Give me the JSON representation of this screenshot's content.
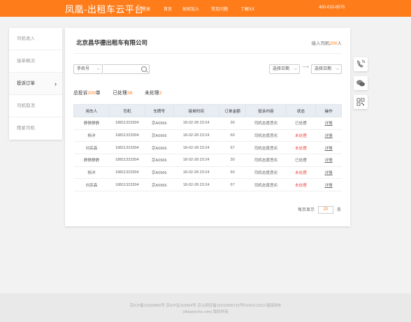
{
  "header": {
    "brand": "凤凰-出租车云平台",
    "nav": [
      "登录",
      "首页",
      "如何加入",
      "常见问题",
      "了解XX"
    ],
    "phone": "400-010-8575"
  },
  "sidebar": {
    "items": [
      {
        "label": "司机收入"
      },
      {
        "label": "接单概况"
      },
      {
        "label": "投诉订单",
        "chevron": "›"
      },
      {
        "label": "司机取消"
      },
      {
        "label": "租星司机"
      }
    ]
  },
  "panel": {
    "company": "北京昌华德出租车有限公司",
    "joined_prefix": "接入司机",
    "joined_count": "200",
    "joined_suffix": "人"
  },
  "filters": {
    "field_select": "手机号",
    "search_value": "",
    "date_start": "选择日期",
    "date_end": "选择日期",
    "range_arrow": "⟶"
  },
  "stats": {
    "total_label": "总投诉",
    "total_value": "200",
    "total_unit": "单",
    "done_label": "已处理",
    "done_value": "28",
    "pending_label": "未处理",
    "pending_value": "2"
  },
  "table": {
    "columns": [
      "用车人",
      "司机",
      "车牌号",
      "接单时间",
      "订单金额",
      "投诉内容",
      "状态",
      "操作"
    ],
    "rows": [
      {
        "rider": "静静静静",
        "driver": "18811323304",
        "plate": "京A0966",
        "time": "18-02-28  23:24",
        "amount": "30",
        "content": "司机态度恶劣",
        "status": "已处理",
        "pending": false,
        "action": "详情"
      },
      {
        "rider": "杨洋",
        "driver": "18811323304",
        "plate": "京A0966",
        "time": "18-02-28  23:24",
        "amount": "60",
        "content": "司机态度恶劣",
        "status": "未处理",
        "pending": true,
        "action": "详情"
      },
      {
        "rider": "刘亮森",
        "driver": "18811323304",
        "plate": "京A0966",
        "time": "18-02-28  23:24",
        "amount": "67",
        "content": "司机态度恶劣",
        "status": "未处理",
        "pending": true,
        "action": "详情"
      },
      {
        "rider": "静静静静",
        "driver": "18811323304",
        "plate": "京A0966",
        "time": "18-02-28  23:24",
        "amount": "30",
        "content": "司机态度恶劣",
        "status": "已处理",
        "pending": false,
        "action": "详情"
      },
      {
        "rider": "杨洋",
        "driver": "18811323304",
        "plate": "京A0966",
        "time": "18-02-28  23:24",
        "amount": "60",
        "content": "司机态度恶劣",
        "status": "未处理",
        "pending": true,
        "action": "详情"
      },
      {
        "rider": "刘亮森",
        "driver": "18811323304",
        "plate": "京A0966",
        "time": "18-02-28  23:24",
        "amount": "67",
        "content": "司机态度恶劣",
        "status": "未处理",
        "pending": true,
        "action": "详情"
      }
    ]
  },
  "pager": {
    "label": "每页显示",
    "value": "20",
    "unit": "条"
  },
  "float_tools": [
    "phone-icon",
    "chat-icon",
    "qrcode-icon"
  ],
  "footer": {
    "line1": "京ICP备10203456号 京ICP证110064号 京公网安备11010500715号©2010-2013 瑞丽网车",
    "line2": "(didapinche.com) 版权所有"
  },
  "colors": {
    "accent": "#ff7c1a",
    "danger": "#f04848",
    "header_row": "#e8ecf3"
  }
}
